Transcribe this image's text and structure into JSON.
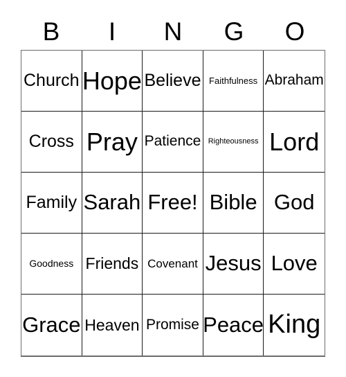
{
  "card": {
    "title": "BINGO",
    "columns": [
      "B",
      "I",
      "N",
      "G",
      "O"
    ],
    "background_color": "#ffffff",
    "text_color": "#000000",
    "border_color": "#1a1a1a",
    "rows": [
      [
        {
          "label": "Church",
          "size": "fs-l"
        },
        {
          "label": "Hope",
          "size": "fs-xxl"
        },
        {
          "label": "Believe",
          "size": "fs-l"
        },
        {
          "label": "Faithfulness",
          "size": "fs-xs"
        },
        {
          "label": "Abraham",
          "size": "fs-m"
        }
      ],
      [
        {
          "label": "Cross",
          "size": "fs-l"
        },
        {
          "label": "Pray",
          "size": "fs-xxl"
        },
        {
          "label": "Patience",
          "size": "fs-m"
        },
        {
          "label": "Righteousness",
          "size": "fs-xxs"
        },
        {
          "label": "Lord",
          "size": "fs-xxl"
        }
      ],
      [
        {
          "label": "Family",
          "size": "fs-l"
        },
        {
          "label": "Sarah",
          "size": "fs-xl"
        },
        {
          "label": "Free!",
          "size": "fs-xl"
        },
        {
          "label": "Bible",
          "size": "fs-xl"
        },
        {
          "label": "God",
          "size": "fs-xl"
        }
      ],
      [
        {
          "label": "Goodness",
          "size": "fs-s"
        },
        {
          "label": "Friends",
          "size": "fs-ml"
        },
        {
          "label": "Covenant",
          "size": "fs-sm"
        },
        {
          "label": "Jesus",
          "size": "fs-xl"
        },
        {
          "label": "Love",
          "size": "fs-xl"
        }
      ],
      [
        {
          "label": "Grace",
          "size": "fs-xl"
        },
        {
          "label": "Heaven",
          "size": "fs-ml"
        },
        {
          "label": "Promise",
          "size": "fs-m"
        },
        {
          "label": "Peace",
          "size": "fs-xl"
        },
        {
          "label": "King",
          "size": "fs-max"
        }
      ]
    ]
  }
}
